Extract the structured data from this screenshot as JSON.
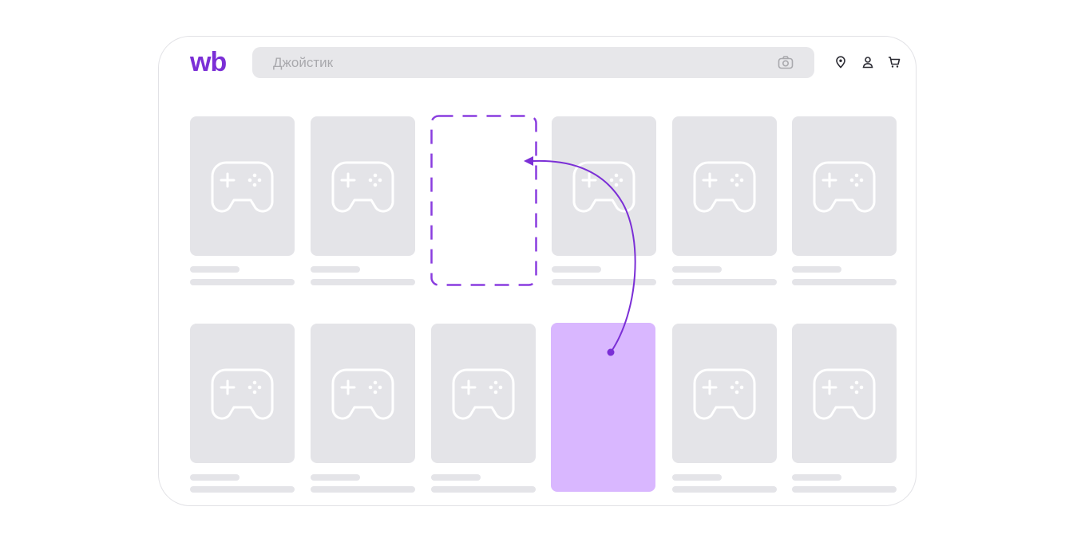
{
  "brand": {
    "logo_text": "wb",
    "color": "#7b2fd6"
  },
  "search": {
    "placeholder": "Джойстик",
    "camera_icon": "camera-icon"
  },
  "header_icons": [
    "location-pin-icon",
    "user-icon",
    "cart-icon"
  ],
  "colors": {
    "placeholder_card": "#e4e4e8",
    "highlight_card": "#d9b7ff",
    "accent": "#7b2fd6"
  },
  "grid": {
    "rows": 2,
    "columns": 6,
    "moved_from": {
      "row": 2,
      "column": 4
    },
    "moved_to": {
      "row": 1,
      "column": 3
    }
  }
}
